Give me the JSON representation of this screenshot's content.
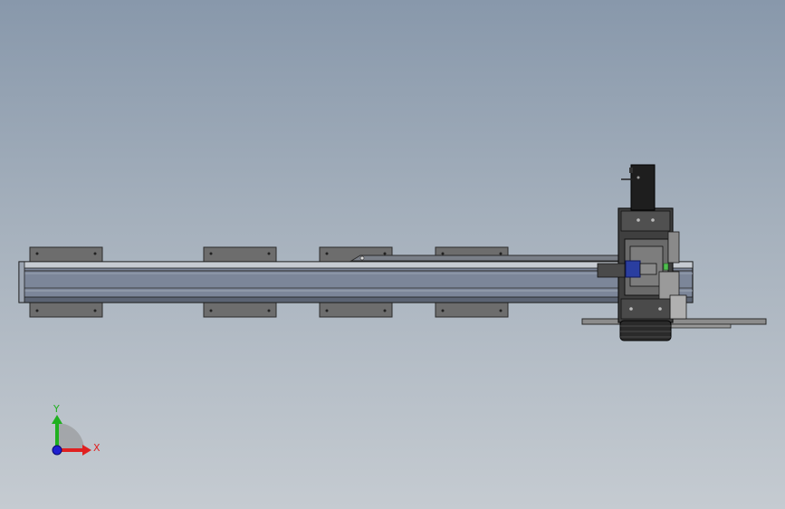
{
  "viewport": {
    "background_top": "#8898ab",
    "background_bottom": "#c5cbd1"
  },
  "model": {
    "rail_color": "#7c8699",
    "bracket_color": "#6d6d6d",
    "carriage_color": "#3f3f3f",
    "motor_color": "#1e1e1e",
    "highlight_color": "#2a3ea0",
    "sensor_color": "#4fbf4f"
  },
  "triad": {
    "x_label": "X",
    "y_label": "Y",
    "x_color": "#e02020",
    "y_color": "#20b020",
    "z_color": "#2020d0"
  }
}
